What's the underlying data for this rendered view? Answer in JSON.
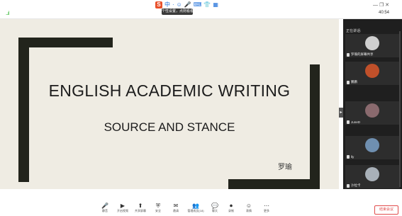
{
  "topbar": {
    "signal": "...ıl",
    "time": "40:54",
    "window_controls": "— ❐ ✕",
    "ime": {
      "logo": "S",
      "items": [
        "中",
        "·",
        "☺",
        "🎤",
        "⌨",
        "👕",
        "▦"
      ]
    },
    "tooltip": "个性设置，点则看看"
  },
  "slide": {
    "title": "ENGLISH ACADEMIC WRITING",
    "subtitle": "SOURCE AND STANCE",
    "author": "罗瑜"
  },
  "panel": {
    "header": "正在讲话:",
    "participants": [
      {
        "name": "罗瑜的屏幕共享",
        "avatar_color": "#cfcfcf"
      },
      {
        "name": "鹏鹏",
        "avatar_color": "#c0502a"
      },
      {
        "name": "JuneD",
        "avatar_color": "#8a6a6e"
      },
      {
        "name": "lly",
        "avatar_color": "#6f8fb0"
      },
      {
        "name": "沙拉卡",
        "avatar_color": "#a8b0b8"
      }
    ]
  },
  "toolbar": {
    "buttons": [
      {
        "label": "静音",
        "icon": "🎤"
      },
      {
        "label": "开启视频",
        "icon": "▶"
      },
      {
        "label": "共享屏幕",
        "icon": "⬆"
      },
      {
        "label": "安全",
        "icon": "⛨"
      },
      {
        "label": "邀请",
        "icon": "✉"
      },
      {
        "label": "管理成员(18)",
        "icon": "👥"
      },
      {
        "label": "聊天",
        "icon": "💬"
      },
      {
        "label": "录制",
        "icon": "⏺"
      },
      {
        "label": "表情",
        "icon": "☺"
      },
      {
        "label": "更多",
        "icon": "⋯"
      }
    ],
    "end_meeting": "结束会议"
  }
}
